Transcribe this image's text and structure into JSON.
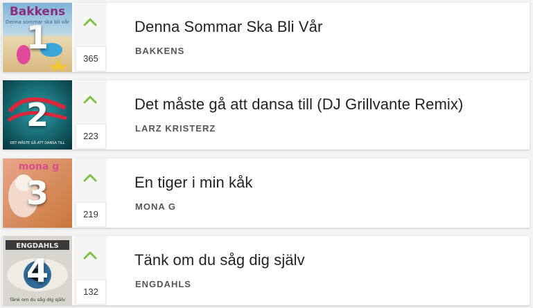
{
  "colors": {
    "accent": "#7dc243",
    "title": "#222222",
    "artist": "#555555"
  },
  "songs": [
    {
      "rank": "1",
      "title": "Denna Sommar Ska Bli Vår",
      "artist": "BAKKENS",
      "score": "365",
      "cover_text": "Bakkens",
      "cover_subtitle": "Denna sommar ska bli vår"
    },
    {
      "rank": "2",
      "title": "Det måste gå att dansa till (DJ Grillvante Remix)",
      "artist": "LARZ KRISTERZ",
      "score": "223",
      "cover_subtitle": "DET MÅSTE GÅ ATT DANSA TILL"
    },
    {
      "rank": "3",
      "title": "En tiger i min kåk",
      "artist": "MONA G",
      "score": "219",
      "cover_text": "mona g"
    },
    {
      "rank": "4",
      "title": "Tänk om du såg dig själv",
      "artist": "ENGDAHLS",
      "score": "132",
      "cover_text": "ENGDAHLS",
      "cover_subtitle": "Tänk om du såg dig själv"
    }
  ]
}
